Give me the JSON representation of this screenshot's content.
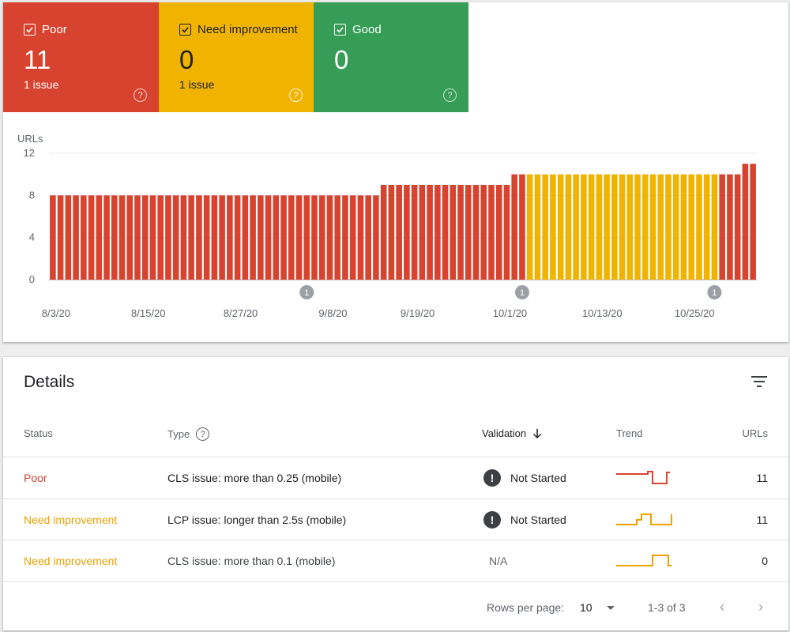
{
  "summary": {
    "poor": {
      "label": "Poor",
      "count": "11",
      "issues": "1 issue",
      "color": "#d7432f"
    },
    "need_improvement": {
      "label": "Need improvement",
      "count": "0",
      "issues": "1 issue",
      "color": "#f0b400"
    },
    "good": {
      "label": "Good",
      "count": "0",
      "issues": "",
      "color": "#359d55"
    }
  },
  "chart_data": {
    "type": "bar",
    "ylabel": "URLs",
    "ylim": [
      0,
      12
    ],
    "yticks": [
      0,
      4,
      8,
      12
    ],
    "xtick_labels": [
      "8/3/20",
      "8/15/20",
      "8/27/20",
      "9/8/20",
      "9/19/20",
      "10/1/20",
      "10/13/20",
      "10/25/20"
    ],
    "annotations": [
      "1",
      "1",
      "1"
    ],
    "series": [
      {
        "color": "#d7432f",
        "values": [
          8,
          8,
          8,
          8,
          8,
          8,
          8,
          8,
          8,
          8,
          8,
          8,
          8,
          8,
          8,
          8,
          8,
          8,
          8,
          8,
          8,
          8,
          8,
          8,
          8,
          8,
          8,
          8,
          8,
          8,
          8,
          8,
          8,
          8,
          8,
          8,
          8,
          8,
          8,
          8,
          8,
          8,
          8,
          9,
          9,
          9,
          9,
          9,
          9,
          9,
          9,
          9,
          9,
          9,
          9,
          9,
          9,
          9,
          9,
          9,
          10,
          10,
          0,
          0,
          0,
          0,
          0,
          0,
          0,
          0,
          0,
          0,
          0,
          0,
          0,
          0,
          0,
          0,
          0,
          0,
          0,
          0,
          0,
          0,
          0,
          0,
          0,
          10,
          10,
          10,
          11,
          11
        ]
      },
      {
        "color": "#f0b400",
        "values": [
          0,
          0,
          0,
          0,
          0,
          0,
          0,
          0,
          0,
          0,
          0,
          0,
          0,
          0,
          0,
          0,
          0,
          0,
          0,
          0,
          0,
          0,
          0,
          0,
          0,
          0,
          0,
          0,
          0,
          0,
          0,
          0,
          0,
          0,
          0,
          0,
          0,
          0,
          0,
          0,
          0,
          0,
          0,
          0,
          0,
          0,
          0,
          0,
          0,
          0,
          0,
          0,
          0,
          0,
          0,
          0,
          0,
          0,
          0,
          0,
          0,
          0,
          10,
          10,
          10,
          10,
          10,
          10,
          10,
          10,
          10,
          10,
          10,
          10,
          10,
          10,
          10,
          10,
          10,
          10,
          10,
          10,
          10,
          10,
          10,
          10,
          10,
          0,
          0,
          0,
          0,
          0
        ]
      }
    ]
  },
  "details": {
    "title": "Details",
    "columns": {
      "status": "Status",
      "type": "Type",
      "validation": "Validation",
      "trend": "Trend",
      "urls": "URLs"
    },
    "rows": [
      {
        "status": "Poor",
        "type": "CLS issue: more than 0.25 (mobile)",
        "validation": "Not Started",
        "urls": "11",
        "trend_color": "#d7432f"
      },
      {
        "status": "Need improvement",
        "type": "LCP issue: longer than 2.5s (mobile)",
        "validation": "Not Started",
        "urls": "11",
        "trend_color": "#f0a000"
      },
      {
        "status": "Need improvement",
        "type": "CLS issue: more than 0.1 (mobile)",
        "validation": "N/A",
        "urls": "0",
        "trend_color": "#f0a000"
      }
    ],
    "footer": {
      "rows_per_page_label": "Rows per page:",
      "rows_per_page_value": "10",
      "range": "1-3 of 3"
    }
  }
}
